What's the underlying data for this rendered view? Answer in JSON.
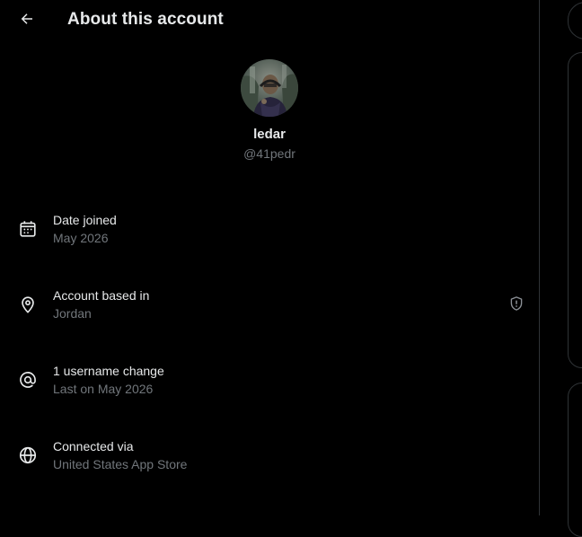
{
  "header": {
    "title": "About this account",
    "back_icon": "arrow-left-icon"
  },
  "profile": {
    "display_name": "ledar",
    "handle": "@41pedr"
  },
  "rows": [
    {
      "icon": "calendar-icon",
      "label": "Date joined",
      "value": "May 2026"
    },
    {
      "icon": "location-pin-icon",
      "label": "Account based in",
      "value": "Jordan"
    },
    {
      "icon": "at-sign-icon",
      "label": "1 username change",
      "value": "Last on May 2026"
    },
    {
      "icon": "globe-icon",
      "label": "Connected via",
      "value": "United States App Store"
    }
  ],
  "colors": {
    "background": "#000000",
    "primary_text": "#e7e9ea",
    "secondary_text": "#71767b",
    "border": "#2f3336"
  }
}
